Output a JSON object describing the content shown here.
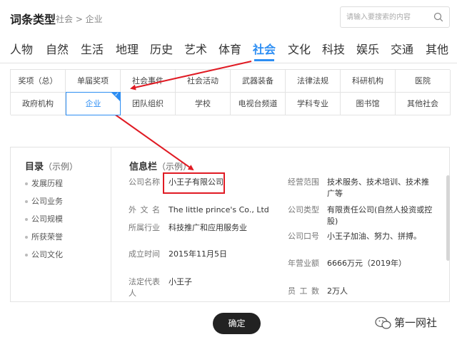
{
  "header": {
    "title": "词条类型",
    "breadcrumb": "社会 > 企业",
    "search_placeholder": "请输入要搜索的内容"
  },
  "nav": {
    "items": [
      "人物",
      "自然",
      "生活",
      "地理",
      "历史",
      "艺术",
      "体育",
      "社会",
      "文化",
      "科技",
      "娱乐",
      "交通",
      "其他"
    ],
    "active": "社会"
  },
  "subcategories": {
    "row1": [
      "奖项（总）",
      "单届奖项",
      "社会事件",
      "社会活动",
      "武器装备",
      "法律法规",
      "科研机构",
      "医院"
    ],
    "row2": [
      "政府机构",
      "企业",
      "团队组织",
      "学校",
      "电视台频道",
      "学科专业",
      "图书馆",
      "其他社会"
    ],
    "selected": "企业"
  },
  "toc": {
    "title": "目录",
    "subtitle": "（示例）",
    "items": [
      "发展历程",
      "公司业务",
      "公司规模",
      "所获荣誉",
      "公司文化"
    ]
  },
  "infobox": {
    "title": "信息栏",
    "subtitle": "（示例）",
    "left": [
      {
        "label": "公司名称",
        "value": "小王子有限公司"
      },
      {
        "label": "外文名",
        "value": "The little prince's Co., Ltd"
      },
      {
        "label": "所属行业",
        "value": "科技推广和应用服务业"
      },
      {
        "label": "成立时间",
        "value": "2015年11月5日"
      },
      {
        "label": "法定代表人",
        "value": "小王子"
      }
    ],
    "right": [
      {
        "label": "经营范围",
        "value": "技术服务、技术培训、技术推广等"
      },
      {
        "label": "公司类型",
        "value": "有限责任公司(自然人投资或控股)"
      },
      {
        "label": "公司口号",
        "value": "小王子加油、努力、拼搏。"
      },
      {
        "label": "年营业额",
        "value": "6666万元（2019年）"
      },
      {
        "label": "员工数",
        "value": "2万人"
      }
    ]
  },
  "buttons": {
    "confirm": "确定"
  },
  "watermark": "第一网社",
  "colors": {
    "accent": "#2d8ef3",
    "highlight": "#e01b24",
    "button_bg": "#222222"
  }
}
